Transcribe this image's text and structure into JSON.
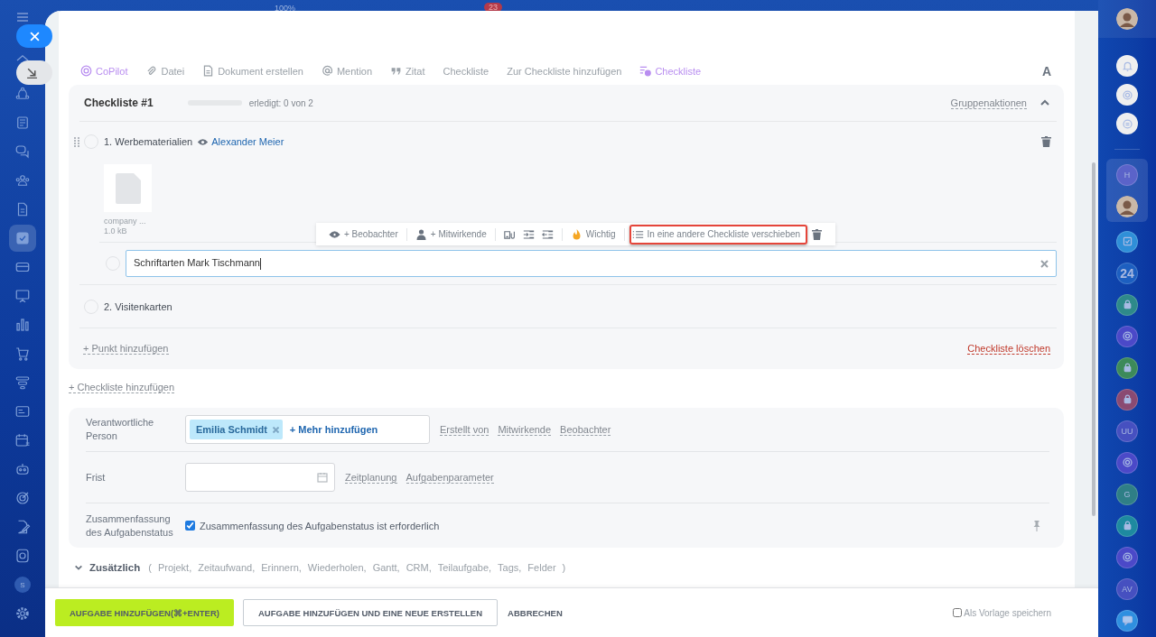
{
  "top_bar": {
    "zoom": "100%",
    "badge": "23"
  },
  "left_nav": {
    "items": [
      {
        "kind": "home",
        "selected": false
      },
      {
        "kind": "network",
        "selected": false
      },
      {
        "kind": "feed",
        "selected": false
      },
      {
        "kind": "chat",
        "selected": false
      },
      {
        "kind": "people",
        "selected": false
      },
      {
        "kind": "doc",
        "selected": false
      },
      {
        "kind": "tasks",
        "selected": true
      },
      {
        "kind": "card",
        "selected": false
      },
      {
        "kind": "presentation",
        "selected": false
      },
      {
        "kind": "chart",
        "selected": false
      },
      {
        "kind": "cart",
        "selected": false
      },
      {
        "kind": "filter",
        "selected": false
      },
      {
        "kind": "idcard",
        "selected": false
      },
      {
        "kind": "calendar",
        "selected": false
      },
      {
        "kind": "robot",
        "selected": false
      },
      {
        "kind": "target",
        "selected": false
      },
      {
        "kind": "edit",
        "selected": false
      },
      {
        "kind": "box",
        "selected": false
      },
      {
        "kind": "letter",
        "text": "S",
        "selected": false
      },
      {
        "kind": "gear",
        "selected": false
      }
    ]
  },
  "editor_toolbar": {
    "items": [
      {
        "kind": "copilot",
        "label": "CoPilot",
        "accent": true
      },
      {
        "kind": "file",
        "label": "Datei",
        "accent": false
      },
      {
        "kind": "document",
        "label": "Dokument erstellen",
        "accent": false
      },
      {
        "kind": "mention",
        "label": "Mention",
        "accent": false
      },
      {
        "kind": "quote",
        "label": "Zitat",
        "accent": false
      },
      {
        "kind": "text",
        "label": "Checkliste",
        "accent": false
      },
      {
        "kind": "text",
        "label": "Zur Checkliste hinzufügen",
        "accent": false
      },
      {
        "kind": "checklist",
        "label": "Checkliste",
        "accent": true
      }
    ],
    "format": "A"
  },
  "checklist": {
    "title": "Checkliste #1",
    "level": 0,
    "progress_text": "erledigt: 0 von 2",
    "group_actions": "Gruppenaktionen",
    "expanded": true,
    "items": [
      {
        "label": "1. Werbematerialien",
        "checked": false,
        "watcher": "Alexander Meier",
        "attachments": [
          {
            "name": "company ...",
            "size": "1.0 kB"
          }
        ],
        "children": [
          {
            "value": "Schriftarten Mark Tischmann",
            "checked": false
          }
        ]
      },
      {
        "label": "2. Visitenkarten",
        "checked": false
      }
    ],
    "add_item": "+ Punkt hinzufügen",
    "delete": "Checkliste löschen"
  },
  "item_toolbar": {
    "items": [
      {
        "kind": "watcher",
        "label": "+ Beobachter",
        "highlighted": false
      },
      {
        "kind": "participant",
        "label": "+ Mitwirkende",
        "highlighted": false
      },
      {
        "kind": "attach",
        "highlighted": false
      },
      {
        "kind": "indent",
        "highlighted": false
      },
      {
        "kind": "outdent",
        "highlighted": false
      },
      {
        "kind": "important",
        "label": "Wichtig",
        "highlighted": false
      },
      {
        "kind": "move",
        "label": "In eine andere Checkliste verschieben",
        "highlighted": true
      },
      {
        "kind": "delete",
        "highlighted": false
      }
    ]
  },
  "add_checklist": "+ Checkliste hinzufügen",
  "fields": {
    "responsible": {
      "label": "Verantwortliche Person",
      "chips": [
        "Emilia Schmidt"
      ],
      "add": "+ Mehr hinzufügen",
      "links": [
        "Erstellt von",
        "Mitwirkende",
        "Beobachter"
      ]
    },
    "deadline": {
      "label": "Frist",
      "links": [
        "Zeitplanung",
        "Aufgabenparameter"
      ]
    },
    "summary": {
      "label": "Zusammenfassung des Aufgabenstatus",
      "checked": true,
      "text": "Zusammenfassung des Aufgabenstatus ist erforderlich"
    }
  },
  "extra": {
    "label": "Zusätzlich",
    "open": "(",
    "items": [
      "Projekt,",
      "Zeitaufwand,",
      "Erinnern,",
      "Wiederholen,",
      "Gantt,",
      "CRM,",
      "Teilaufgabe,",
      "Tags,",
      "Felder"
    ],
    "close": ")"
  },
  "footer": {
    "buttons": [
      {
        "kind": "primary",
        "label": "AUFGABE HINZUFÜGEN(⌘+ENTER)"
      },
      {
        "kind": "outline",
        "label": "AUFGABE HINZUFÜGEN UND EINE NEUE ERSTELLEN"
      },
      {
        "kind": "plain",
        "label": "ABBRECHEN"
      }
    ],
    "template": {
      "label": "Als Vorlage speichern",
      "checked": false
    }
  },
  "right_bar": {
    "top": [
      {
        "kind": "avatar"
      }
    ],
    "tools": [
      {
        "kind": "bell"
      },
      {
        "kind": "swirl"
      },
      {
        "kind": "chat"
      }
    ],
    "group": [
      {
        "kind": "letter",
        "text": "H",
        "color": "#5b63c9"
      },
      {
        "kind": "avatar"
      }
    ],
    "items": [
      {
        "kind": "tasks",
        "color": "#2f8fd8"
      },
      {
        "kind": "letter",
        "text": "24",
        "color": "#1d5fc0"
      },
      {
        "kind": "lock",
        "color": "#2e8a8a"
      },
      {
        "kind": "swirl",
        "color": "#4b49c8"
      },
      {
        "kind": "lock",
        "color": "#3d8a5a"
      },
      {
        "kind": "lock",
        "color": "#8a4a72"
      },
      {
        "kind": "letter",
        "text": "UU",
        "color": "#4650c0"
      },
      {
        "kind": "swirl",
        "color": "#4b49c8"
      },
      {
        "kind": "letter",
        "text": "G",
        "color": "#2f7f86"
      },
      {
        "kind": "lock",
        "color": "#1e8aa0"
      },
      {
        "kind": "swirl",
        "color": "#4b49c8"
      },
      {
        "kind": "letter",
        "text": "AV",
        "color": "#4650c0"
      },
      {
        "kind": "message",
        "color": "#2f8fe0"
      }
    ]
  }
}
